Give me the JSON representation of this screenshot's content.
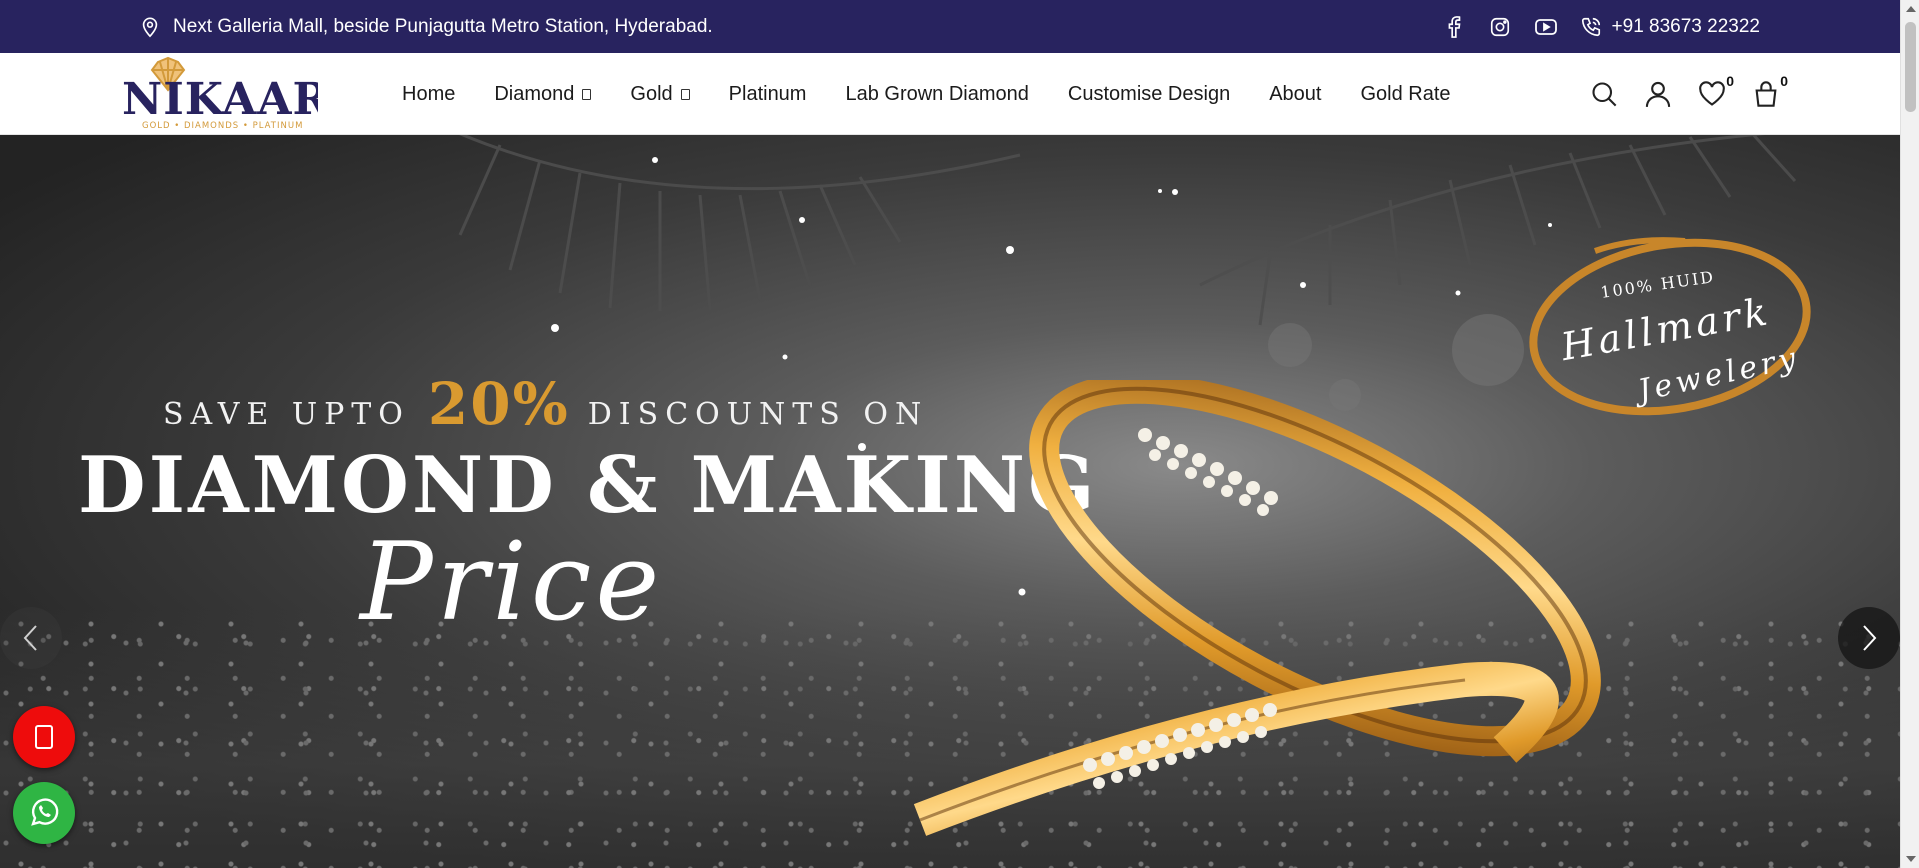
{
  "topbar": {
    "address": "Next Galleria Mall, beside Punjagutta Metro Station, Hyderabad.",
    "phone": "+91 83673 22322",
    "icons": [
      "location-icon",
      "facebook-icon",
      "instagram-icon",
      "youtube-icon",
      "phone-icon"
    ]
  },
  "brand": {
    "name": "NIKAARA",
    "tagline": "GOLD • DIAMONDS • PLATINUM",
    "color": "#28235f",
    "accent": "#d39a3a"
  },
  "nav": {
    "items": [
      {
        "label": "Home",
        "dropdown": false
      },
      {
        "label": "Diamond",
        "dropdown": true
      },
      {
        "label": "Gold",
        "dropdown": true
      },
      {
        "label": "Platinum",
        "dropdown": false
      },
      {
        "label": "Lab Grown Diamond",
        "dropdown": false
      },
      {
        "label": "Customise Design",
        "dropdown": false
      },
      {
        "label": "About",
        "dropdown": false
      },
      {
        "label": "Gold Rate",
        "dropdown": false
      }
    ],
    "wishlist_count": "0",
    "cart_count": "0"
  },
  "hero": {
    "line1_pre": "SAVE UPTO",
    "line1_pct": "20%",
    "line1_post": "DISCOUNTS ON",
    "line2": "DIAMOND & MAKING",
    "line3": "Price",
    "badge_small": "100% HUID",
    "badge_big": "Hallmark",
    "badge_big2": "Jewelery"
  },
  "colors": {
    "topbar_bg": "#28235f",
    "gold": "#d99a30",
    "phone_fab": "#ee0c0c",
    "whatsapp_fab": "#2fb544"
  }
}
